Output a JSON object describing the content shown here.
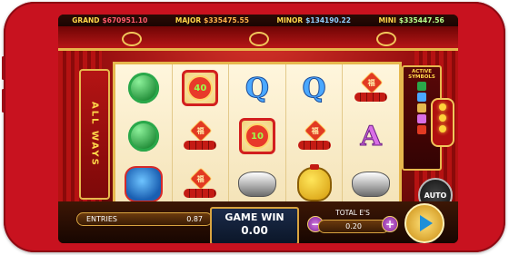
{
  "jackpots": [
    {
      "name": "GRAND",
      "value": "$670951.10"
    },
    {
      "name": "MAJOR",
      "value": "$335475.55"
    },
    {
      "name": "MINOR",
      "value": "$134190.22"
    },
    {
      "name": "MINI",
      "value": "$335447.56"
    }
  ],
  "side_panel": {
    "title": "ALL WAYS"
  },
  "active_symbols": {
    "label": "ACTIVE SYMBOLS"
  },
  "reels": [
    [
      "dragon-jade",
      "dragon-jade",
      "lion"
    ],
    [
      "coin-40",
      "fire-seal",
      "fire-seal"
    ],
    [
      "Q",
      "coin-10",
      "silver-ingot"
    ],
    [
      "Q",
      "fire-seal",
      "gold-bag"
    ],
    [
      "fire-seal",
      "A",
      "silver-ingot"
    ]
  ],
  "coins": {
    "forty": "40",
    "ten": "10"
  },
  "letters": {
    "q": "Q",
    "a": "A"
  },
  "seal_char": "福",
  "bottom": {
    "entries_label": "ENTRIES",
    "entries_value": "0.87",
    "game_win_label": "GAME WIN",
    "game_win_value": "0.00",
    "total_bet_label": "TOTAL E'S",
    "total_bet_value": "0.20",
    "minus": "−",
    "plus": "+"
  },
  "auto_label": "AUTO",
  "colors": {
    "phone": "#c8121f",
    "frame_gold": "#e6b84e",
    "curtain": "#b51212"
  }
}
